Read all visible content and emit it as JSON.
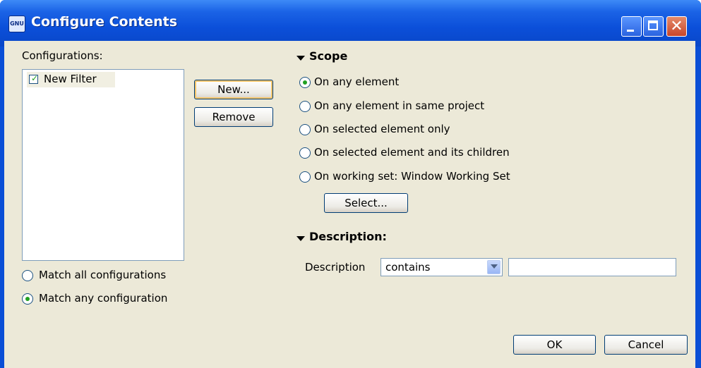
{
  "window": {
    "title": "Configure Contents",
    "app_icon_text": "GNU",
    "controls": [
      "minimize",
      "maximize",
      "close"
    ],
    "close_glyph": "✕"
  },
  "configurations": {
    "label": "Configurations:",
    "items": [
      {
        "label": "New Filter",
        "checked": true
      }
    ],
    "new_button": "New...",
    "remove_button": "Remove"
  },
  "match": {
    "options": [
      {
        "label": "Match all configurations",
        "selected": false
      },
      {
        "label": "Match any configuration",
        "selected": true
      }
    ]
  },
  "scope": {
    "title": "Scope",
    "options": [
      {
        "label": "On any element",
        "selected": true
      },
      {
        "label": "On any element in same project",
        "selected": false
      },
      {
        "label": "On selected element only",
        "selected": false
      },
      {
        "label": "On selected element and its children",
        "selected": false
      },
      {
        "label": "On working set:  Window Working Set",
        "selected": false
      }
    ],
    "select_button": "Select..."
  },
  "description": {
    "title": "Description:",
    "field_label": "Description",
    "operator": "contains",
    "value": ""
  },
  "buttons": {
    "ok": "OK",
    "cancel": "Cancel"
  },
  "colors": {
    "titlebar": "#0a4fd6",
    "dialog_bg": "#ece9d8",
    "radio_dot": "#21a121"
  }
}
